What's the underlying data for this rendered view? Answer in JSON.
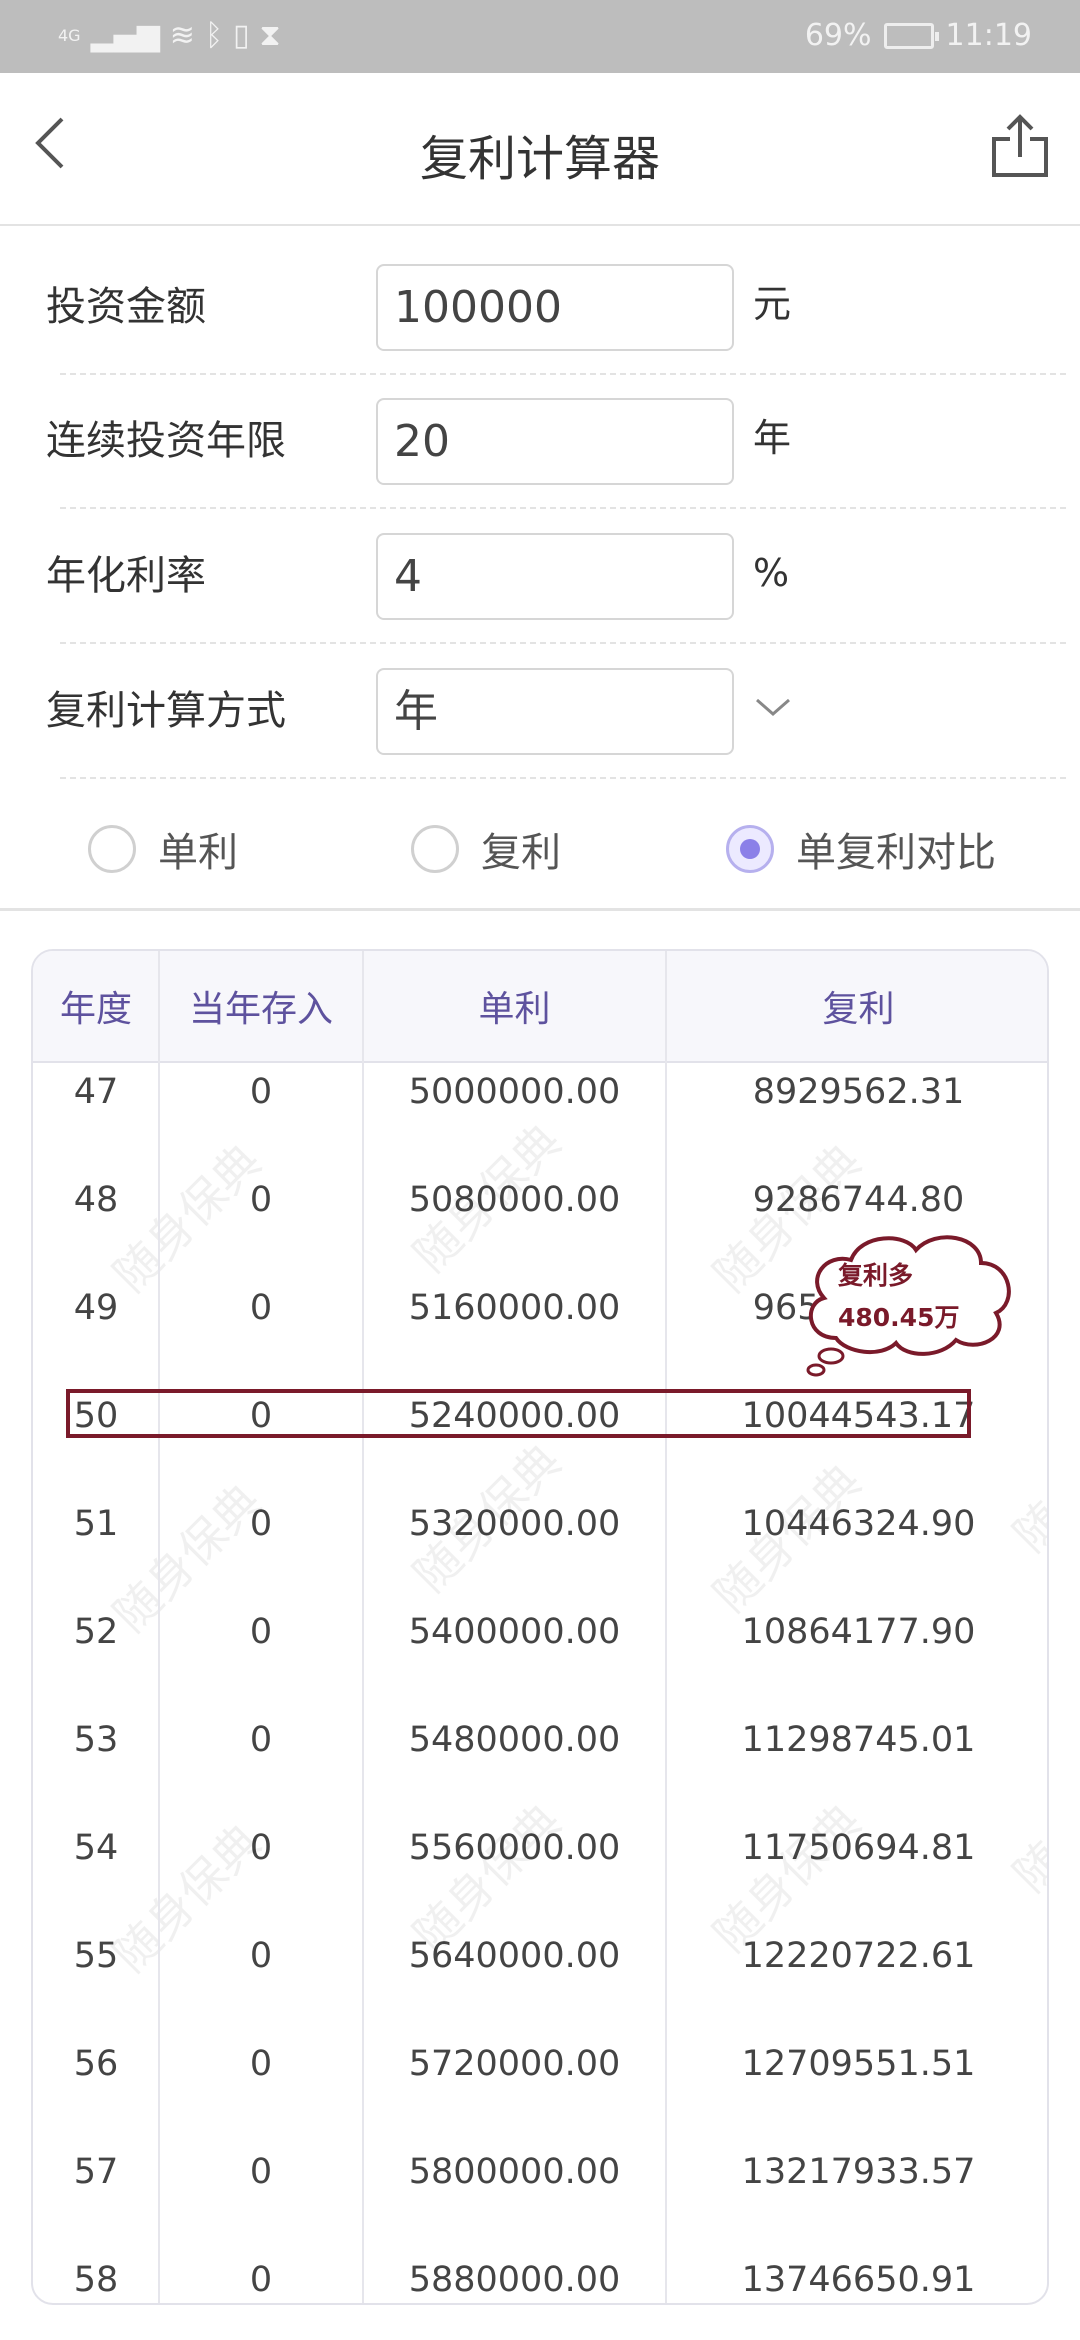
{
  "status_bar": {
    "network": "4G",
    "battery": "69%",
    "time": "11:19"
  },
  "header": {
    "title": "复利计算器"
  },
  "form": [
    {
      "label": "投资金额",
      "value": "100000",
      "unit": "元"
    },
    {
      "label": "连续投资年限",
      "value": "20",
      "unit": "年"
    },
    {
      "label": "年化利率",
      "value": "4",
      "unit": "%"
    },
    {
      "label": "复利计算方式",
      "value": "年",
      "unit": ""
    }
  ],
  "modes": [
    {
      "label": "单利",
      "selected": false
    },
    {
      "label": "复利",
      "selected": false
    },
    {
      "label": "单复利对比",
      "selected": true
    }
  ],
  "table": {
    "headers": [
      "年度",
      "当年存入",
      "单利",
      "复利"
    ],
    "rows": [
      [
        "47",
        "0",
        "5000000.00",
        "8929562.31"
      ],
      [
        "48",
        "0",
        "5080000.00",
        "9286744.80"
      ],
      [
        "49",
        "0",
        "5160000.00",
        "9658214.59"
      ],
      [
        "50",
        "0",
        "5240000.00",
        "10044543.17"
      ],
      [
        "51",
        "0",
        "5320000.00",
        "10446324.90"
      ],
      [
        "52",
        "0",
        "5400000.00",
        "10864177.90"
      ],
      [
        "53",
        "0",
        "5480000.00",
        "11298745.01"
      ],
      [
        "54",
        "0",
        "5560000.00",
        "11750694.81"
      ],
      [
        "55",
        "0",
        "5640000.00",
        "12220722.61"
      ],
      [
        "56",
        "0",
        "5720000.00",
        "12709551.51"
      ],
      [
        "57",
        "0",
        "5800000.00",
        "13217933.57"
      ],
      [
        "58",
        "0",
        "5880000.00",
        "13746650.91"
      ]
    ]
  },
  "watermark": "随身保典",
  "annotation": {
    "line1": "复利多",
    "line2": "480.45万",
    "color": "#7a1a2a"
  }
}
